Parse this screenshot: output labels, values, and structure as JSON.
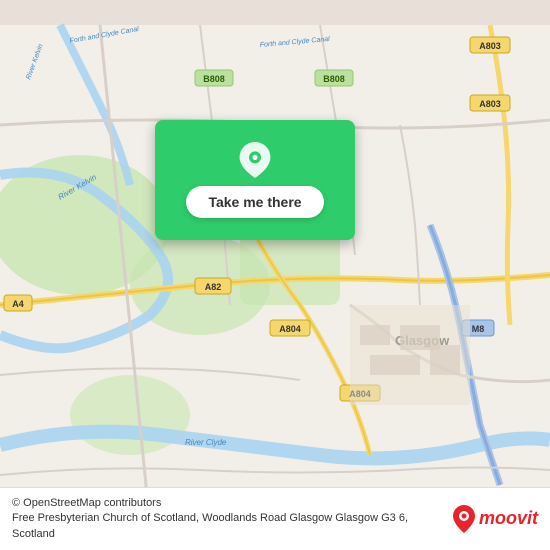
{
  "map": {
    "background_color": "#e8e0d8",
    "attribution_osm": "© OpenStreetMap contributors",
    "location_description": "Free Presbyterian Church of Scotland, Woodlands Road Glasgow Glasgow G3 6, Scotland"
  },
  "action_card": {
    "button_label": "Take me there",
    "pin_icon": "location-pin-icon"
  },
  "branding": {
    "moovit_label": "moovit",
    "moovit_pin_icon": "moovit-pin-icon"
  }
}
